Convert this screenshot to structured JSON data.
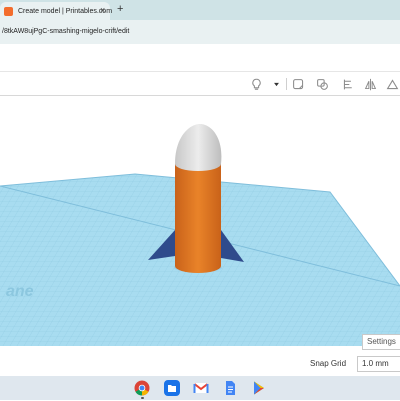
{
  "browser": {
    "tab": {
      "title": "Create model | Printables.com",
      "favicon": "printables-icon",
      "close": "×"
    },
    "new_tab": "+",
    "url": "/8tkAW8ujPgC-smashing-migelo-crift/edit"
  },
  "toolbar": {
    "tools": [
      "light-bulb-icon",
      "dropdown-caret-icon",
      "note-icon",
      "group-icon",
      "align-icon",
      "mirror-icon",
      "flip-icon"
    ]
  },
  "workplane": {
    "watermark": "ane",
    "color": "#a8dcf0"
  },
  "rocket": {
    "body_color": "#e07722",
    "nose_color": "#d9d9d9",
    "fin_color": "#2f4b8c"
  },
  "settings": {
    "label": "Settings"
  },
  "snap_grid": {
    "label": "Snap Grid",
    "value": "1.0 mm"
  },
  "taskbar": {
    "apps": [
      "chrome-icon",
      "files-icon",
      "gmail-icon",
      "docs-icon",
      "play-store-icon"
    ]
  }
}
